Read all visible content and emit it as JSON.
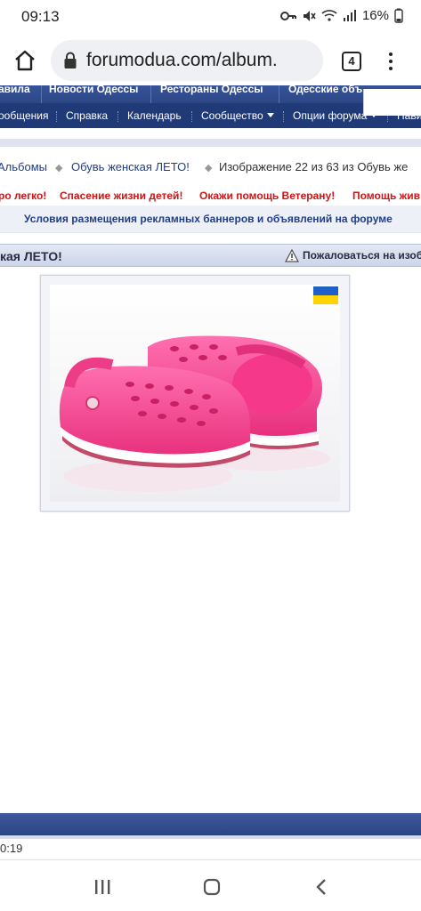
{
  "status_bar": {
    "time": "09:13",
    "battery": "16%"
  },
  "browser": {
    "url": "forumodua.com/album.",
    "tab_count": "4"
  },
  "nav_top": {
    "items": [
      "авила",
      "Новости Одессы",
      "Рестораны Одессы",
      "Одесские объ"
    ]
  },
  "nav_main": {
    "items": [
      "ообщения",
      "Справка",
      "Календарь",
      "Сообщество",
      "Опции форума",
      "Нави"
    ]
  },
  "breadcrumb": {
    "items": [
      "Альбомы",
      "Обувь женская ЛЕТО!",
      "Изображение 22 из 63 из Обувь же"
    ]
  },
  "red_links": [
    "ро легко!",
    "Спасение жизни детей!",
    "Окажи помощь Ветерану!",
    "Помощь жив"
  ],
  "ad_notice": "Условия размещения рекламных баннеров и объявлений на форуме",
  "title_bar": {
    "title": "кая ЛЕТО!",
    "report": "Пожаловаться на изобр"
  },
  "image": {
    "alt": "pink clogs",
    "flag_colors": [
      "#1f5fc8",
      "#ffd400"
    ]
  },
  "footer": {
    "time": "0:19"
  },
  "colors": {
    "nav_dark": "#203a78",
    "link": "#223e86",
    "red": "#d11414",
    "clog": "#f2418d"
  }
}
